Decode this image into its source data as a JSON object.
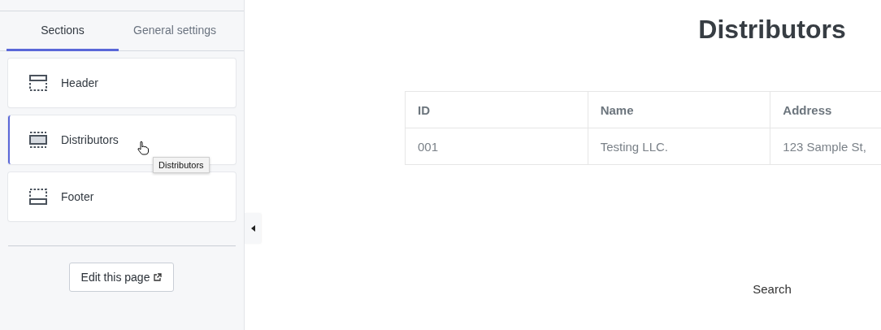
{
  "sidebar": {
    "tabs": [
      {
        "label": "Sections",
        "selected": true
      },
      {
        "label": "General settings",
        "selected": false
      }
    ],
    "sections": [
      {
        "label": "Header",
        "kind": "header",
        "selected": false
      },
      {
        "label": "Distributors",
        "kind": "body",
        "selected": true
      },
      {
        "label": "Footer",
        "kind": "footer",
        "selected": false
      }
    ],
    "tooltip": "Distributors",
    "edit_button": "Edit this page"
  },
  "page": {
    "title": "Distributors",
    "table": {
      "columns": [
        "ID",
        "Name",
        "Address"
      ],
      "rows": [
        [
          "001",
          "Testing LLC.",
          "123 Sample St,"
        ]
      ]
    },
    "search_label": "Search"
  }
}
